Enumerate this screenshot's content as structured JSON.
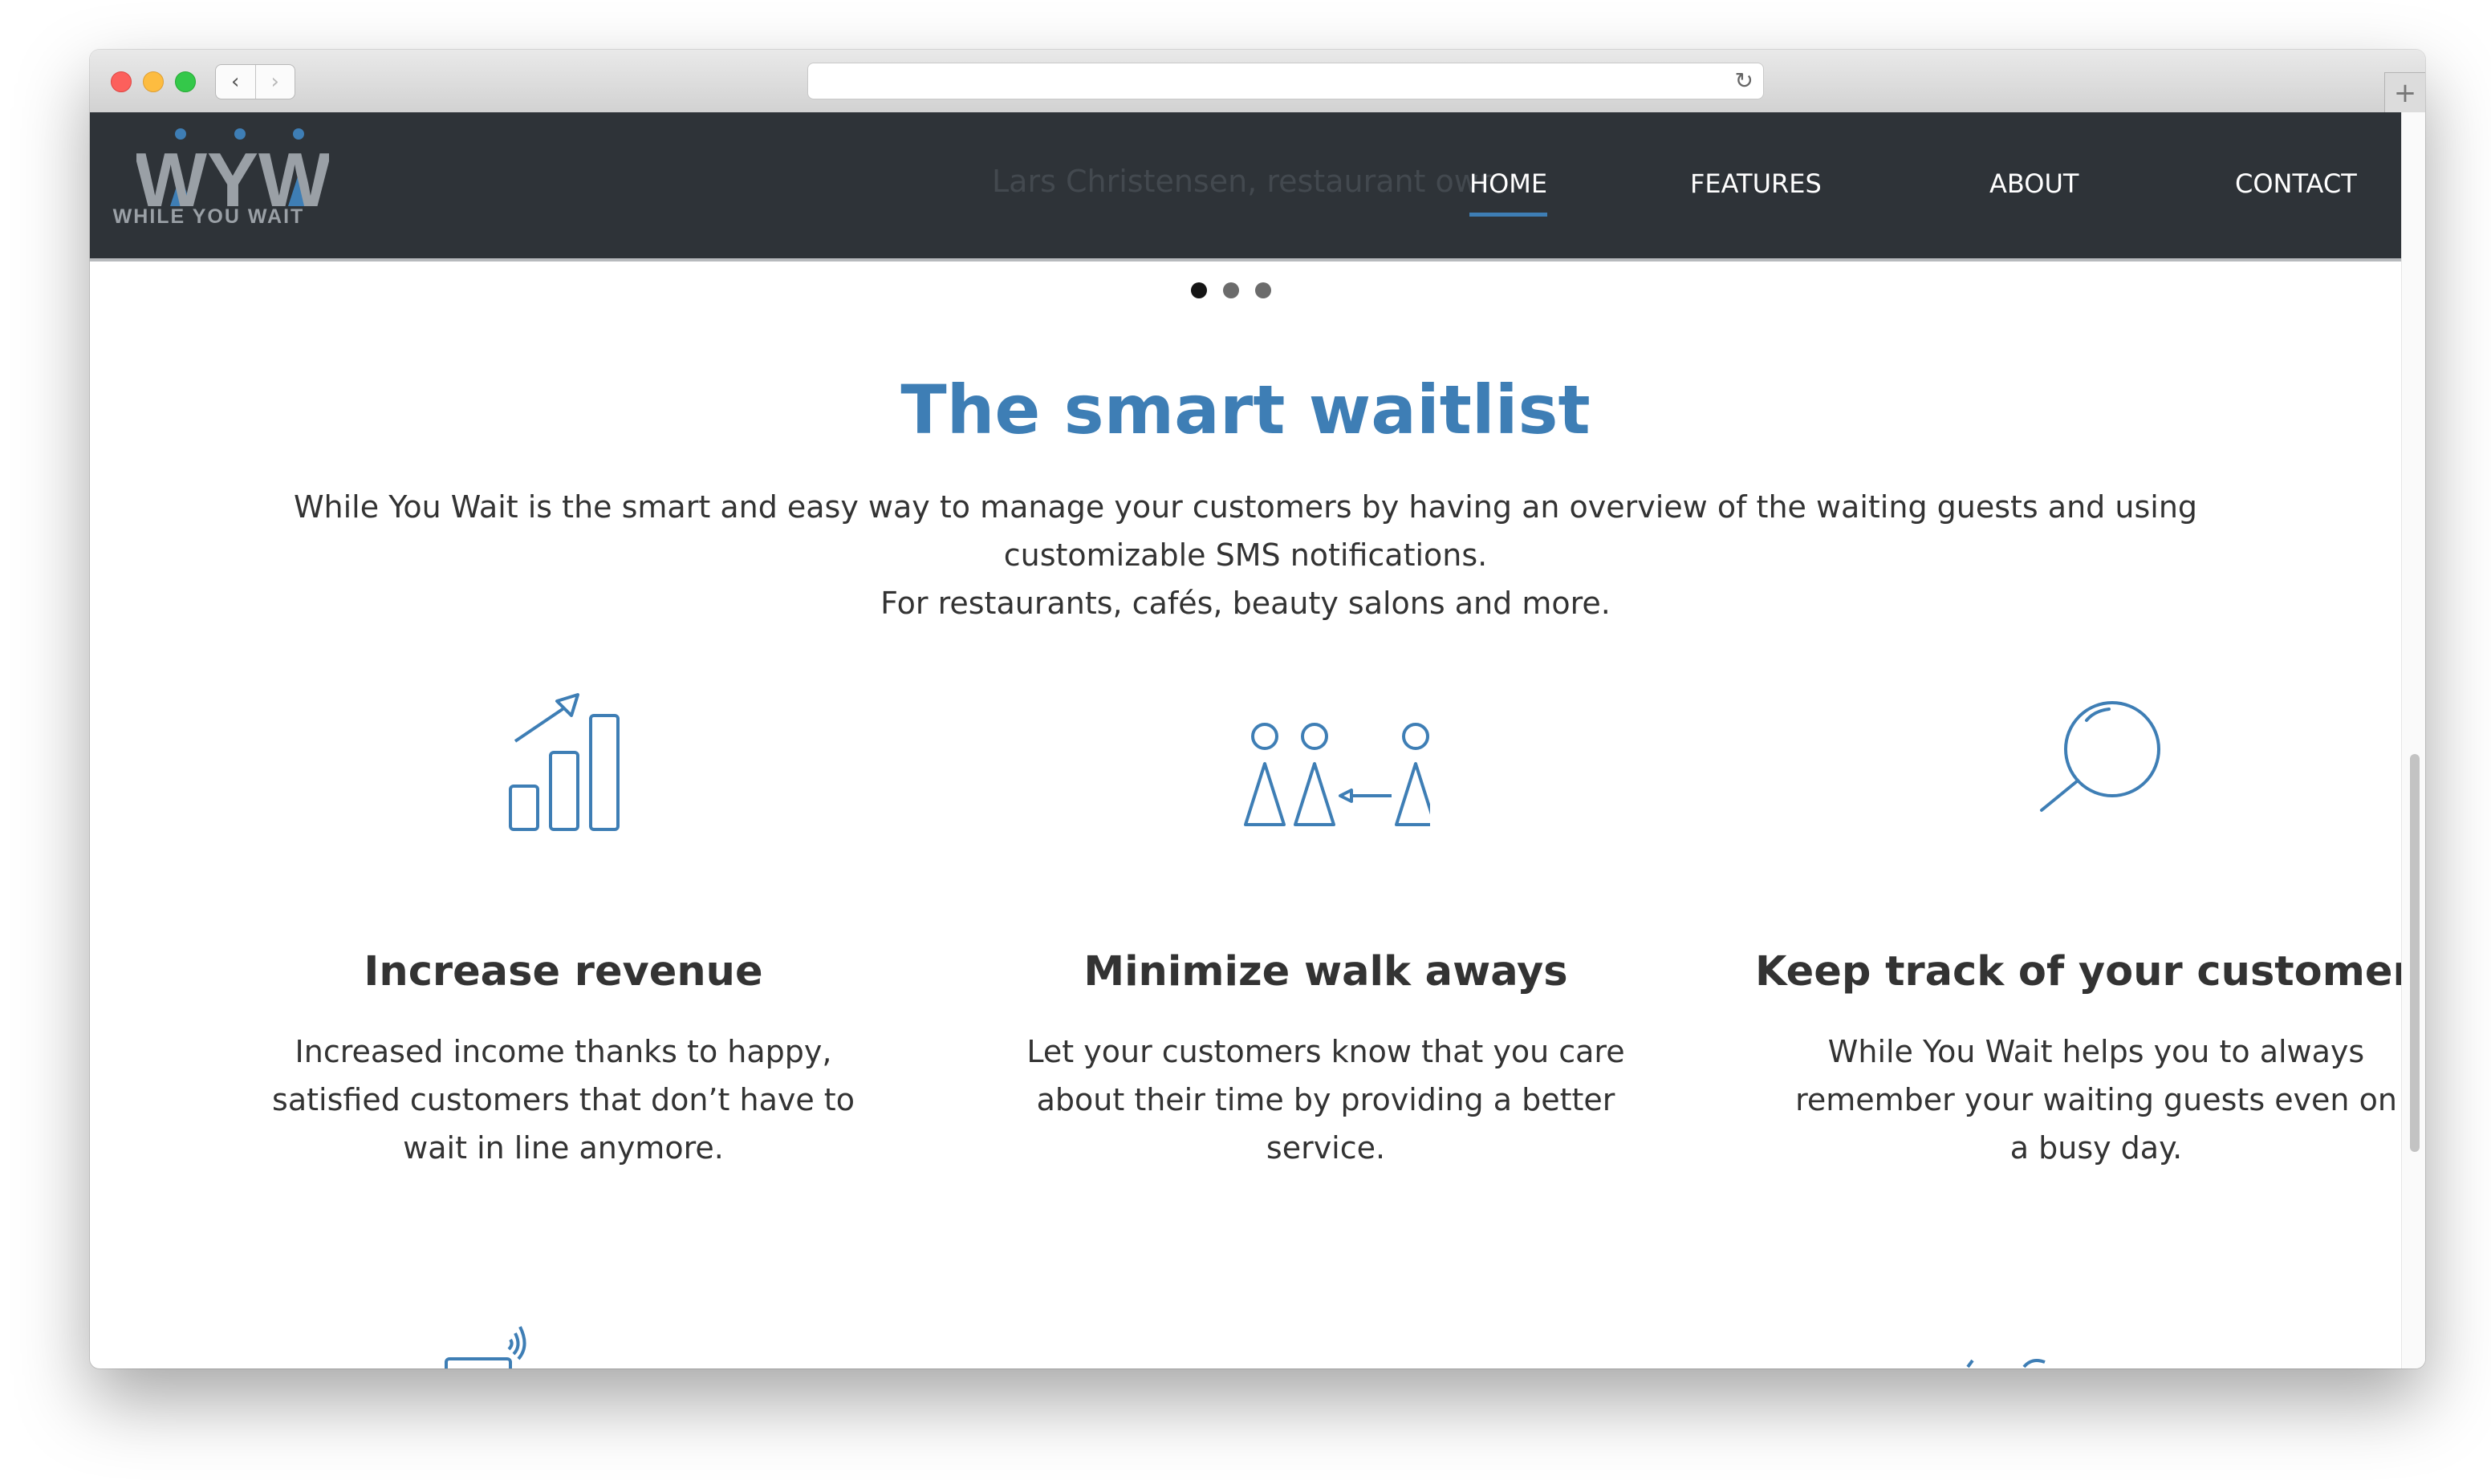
{
  "browser": {
    "back_glyph": "‹",
    "forward_glyph": "›",
    "reload_icon": "↻",
    "new_tab_icon": "+",
    "traffic_lights": [
      "#fc605c",
      "#fdbc40",
      "#34c84a"
    ]
  },
  "header": {
    "logo_text": "WYW",
    "logo_subtitle": "WHILE YOU WAIT",
    "ghost_caption": "Lars Christensen, restaurant owr",
    "nav": {
      "home": "HOME",
      "features": "FEATURES",
      "about": "ABOUT",
      "contact": "CONTACT"
    },
    "active_item": "HOME",
    "accent_color": "#3e7eb5",
    "background_color": "#2e3338"
  },
  "carousel": {
    "dots": 3,
    "active_dot": 1
  },
  "main": {
    "title": "The smart waitlist",
    "intro_line1": "While You Wait is the smart and easy way to manage your customers by having an overview of the waiting guests and using customizable SMS notifications.",
    "intro_line2": "For restaurants, cafés, beauty salons and more.",
    "features": [
      {
        "icon": "bar-chart-growth-icon",
        "title": "Increase revenue",
        "text": "Increased income thanks to happy, satisfied customers that don’t have to wait in line anymore."
      },
      {
        "icon": "people-queue-icon",
        "title": "Minimize walk aways",
        "text": "Let your customers know that you care about their time by providing a better service."
      },
      {
        "icon": "magnifier-icon",
        "title": "Keep track of your customers",
        "text": "While You Wait helps you to always remember your waiting guests even on a busy day."
      }
    ]
  }
}
